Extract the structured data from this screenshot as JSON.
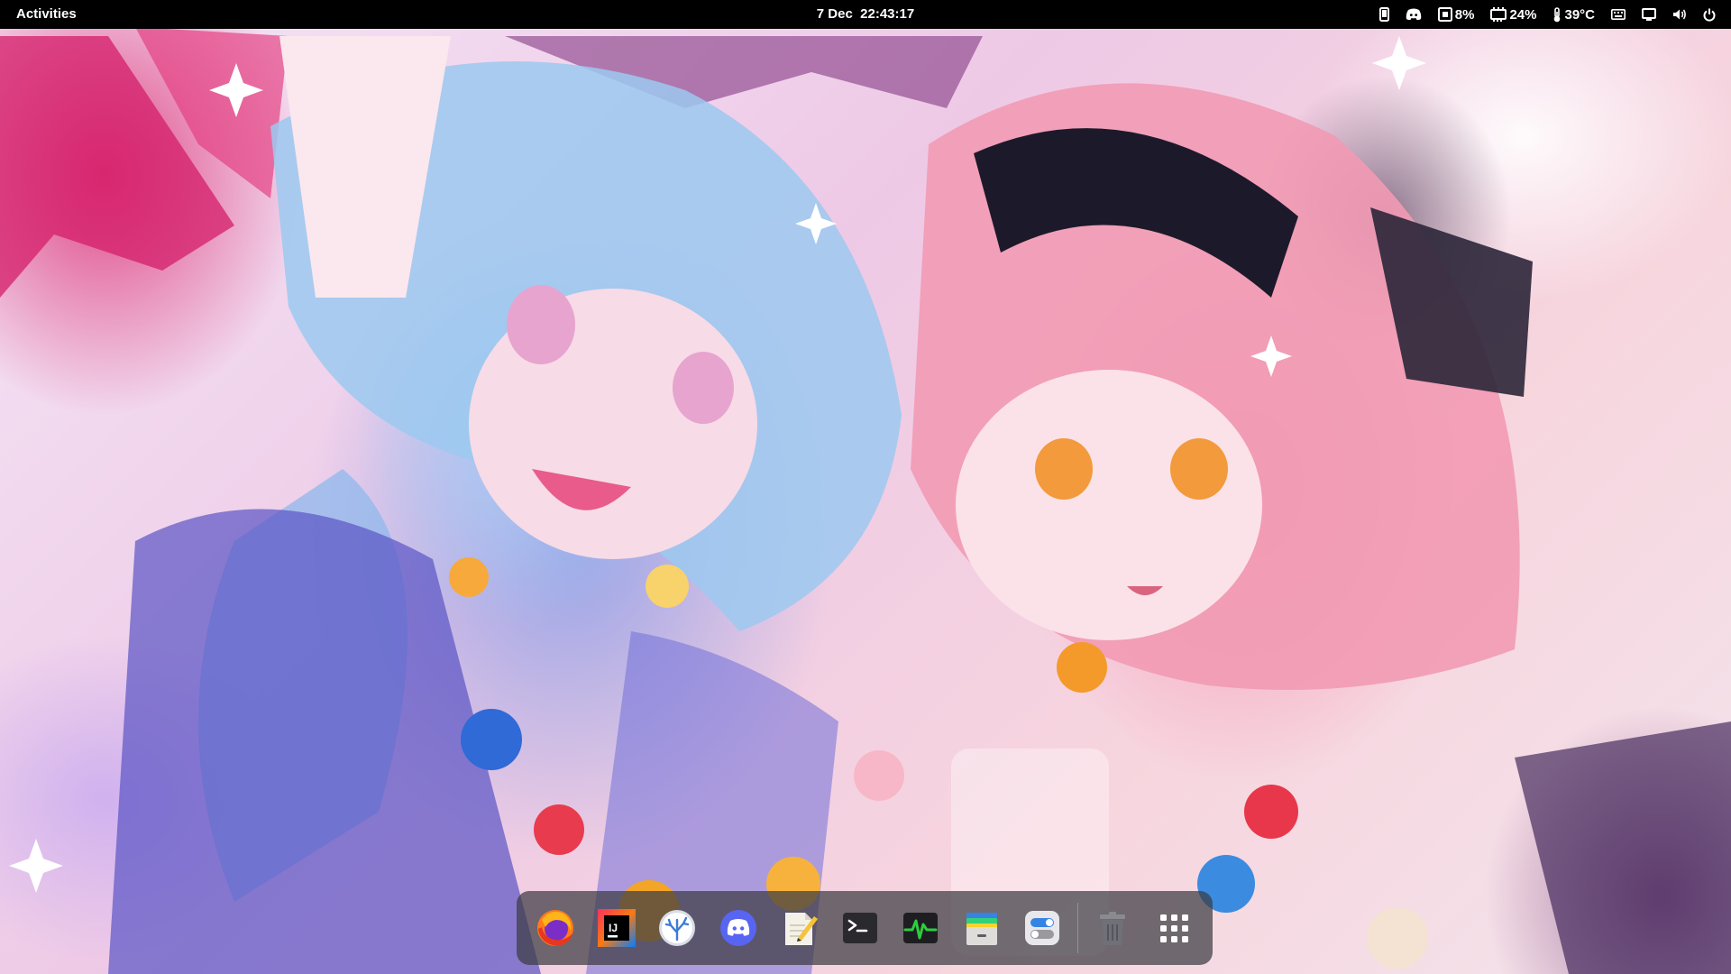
{
  "top_bar": {
    "activities_label": "Activities",
    "clock": "7 Dec  22:43:17",
    "tray": {
      "phone_icon": "phone-icon",
      "discord_icon": "discord-tray-icon",
      "cpu_value": "8%",
      "memory_value": "24%",
      "temperature_value": "39°C",
      "keyboard_icon": "keyboard-icon",
      "display_icon": "display-icon",
      "volume_icon": "volume-icon",
      "power_icon": "power-icon"
    }
  },
  "dock": {
    "items": [
      {
        "name": "Firefox",
        "icon": "firefox-icon"
      },
      {
        "name": "IntelliJ IDEA",
        "icon": "intellij-icon"
      },
      {
        "name": "Wallpaper / Coral app",
        "icon": "coral-icon"
      },
      {
        "name": "Discord",
        "icon": "discord-icon"
      },
      {
        "name": "Text Editor",
        "icon": "text-editor-icon"
      },
      {
        "name": "Terminal",
        "icon": "terminal-icon"
      },
      {
        "name": "System Monitor",
        "icon": "system-monitor-icon"
      },
      {
        "name": "File Archive",
        "icon": "archive-icon"
      },
      {
        "name": "Settings Toggle",
        "icon": "toggle-icon"
      },
      {
        "name": "Trash",
        "icon": "trash-icon"
      },
      {
        "name": "Show Applications",
        "icon": "app-grid-icon"
      }
    ],
    "ij_label": "IJ"
  },
  "colors": {
    "top_bar_bg": "#000000",
    "dock_bg": "#3c3c42",
    "discord_blue": "#5865f2",
    "monitor_green": "#2ecc40"
  }
}
